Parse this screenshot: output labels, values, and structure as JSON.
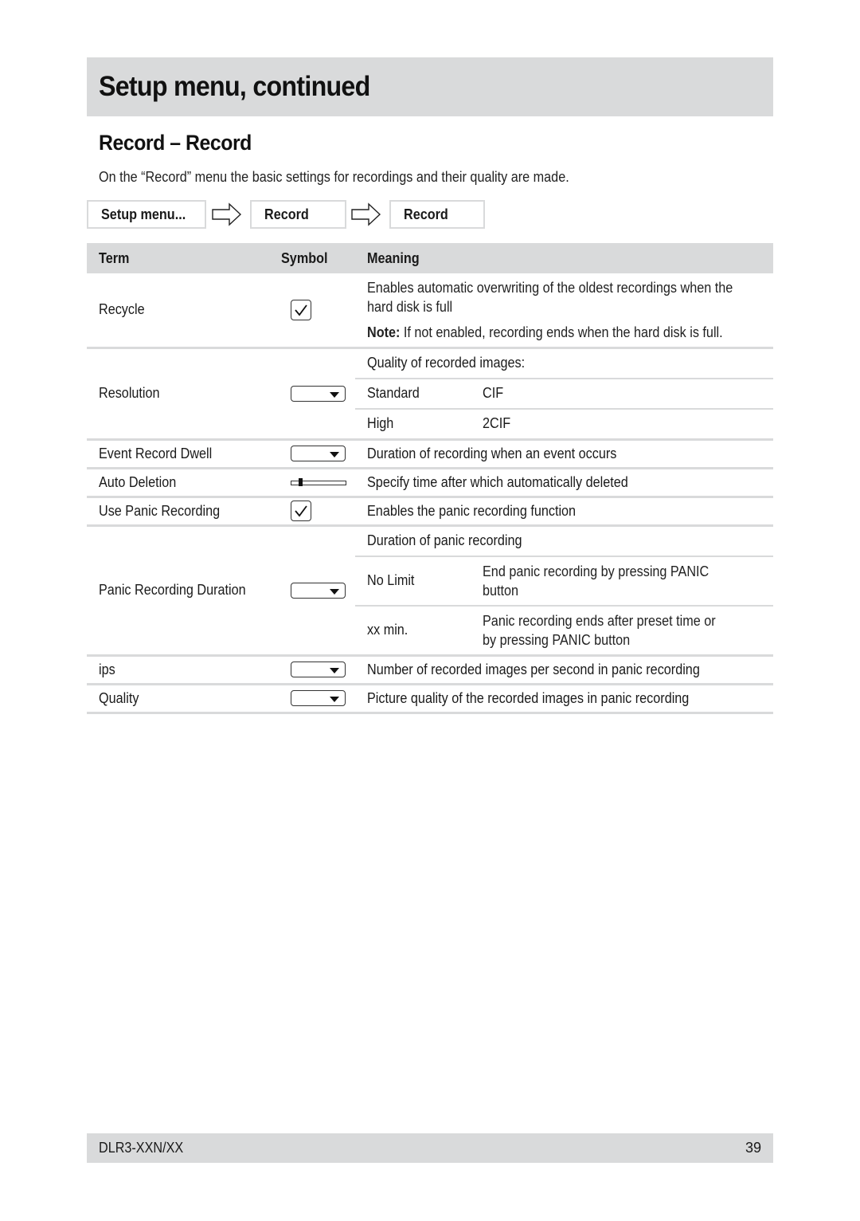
{
  "header": {
    "title": "Setup menu, continued"
  },
  "section": {
    "title": "Record – Record",
    "intro": "On the “Record” menu the basic settings for recordings and their quality are made."
  },
  "breadcrumb": {
    "items": [
      "Setup menu...",
      "Record",
      "Record"
    ],
    "separator_icon": "arrow-right-outline-icon"
  },
  "table": {
    "headers": {
      "term": "Term",
      "symbol": "Symbol",
      "meaning": "Meaning"
    },
    "rows": {
      "recycle": {
        "term": "Recycle",
        "symbol": "checkbox-checked-icon",
        "meaning_line1": "Enables automatic overwriting of the oldest recordings when the",
        "meaning_line2": "hard disk is full",
        "note_label": "Note:",
        "note_text": " If not enabled, recording ends when the hard disk is full."
      },
      "resolution": {
        "term": "Resolution",
        "symbol": "dropdown-icon",
        "meaning": "Quality of recorded images:",
        "options": [
          {
            "label": "Standard",
            "value": "CIF"
          },
          {
            "label": "High",
            "value": "2CIF"
          }
        ]
      },
      "event_record_dwell": {
        "term": "Event Record Dwell",
        "symbol": "dropdown-icon",
        "meaning": "Duration of recording when an event occurs"
      },
      "auto_deletion": {
        "term": "Auto Deletion",
        "symbol": "slider-icon",
        "meaning": "Specify time after which automatically deleted"
      },
      "use_panic_recording": {
        "term": "Use Panic Recording",
        "symbol": "checkbox-checked-icon",
        "meaning": "Enables the panic recording function"
      },
      "panic_recording_duration": {
        "term": "Panic Recording Duration",
        "symbol": "dropdown-icon",
        "meaning": "Duration of panic recording",
        "options": [
          {
            "label": "No Limit",
            "value_line1": "End panic recording by pressing PANIC",
            "value_line2": "button"
          },
          {
            "label": "xx min.",
            "value_line1": "Panic recording ends after preset time or",
            "value_line2": "by pressing PANIC button"
          }
        ]
      },
      "ips": {
        "term": "ips",
        "symbol": "dropdown-icon",
        "meaning": "Number of recorded images per second in panic recording"
      },
      "quality": {
        "term": "Quality",
        "symbol": "dropdown-icon",
        "meaning": "Picture quality of the recorded images in panic recording"
      }
    }
  },
  "footer": {
    "model": "DLR3-XXN/XX",
    "page": "39"
  }
}
